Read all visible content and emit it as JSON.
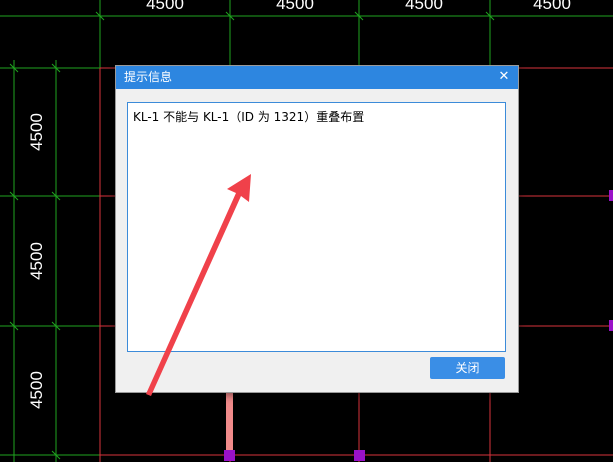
{
  "drawing": {
    "top_dimensions": [
      "4500",
      "4500",
      "4500",
      "4500"
    ],
    "left_dimensions": [
      "4500",
      "4500",
      "4500"
    ],
    "colors": {
      "background": "#000000",
      "grid_green": "#1fa51f",
      "axis_red": "#d8333c",
      "column_purple": "#9a12c8",
      "beam_fill": "#f08a8a",
      "annotation_arrow": "#f0414a"
    }
  },
  "dialog": {
    "title": "提示信息",
    "close_icon": "close-icon",
    "message": "KL-1 不能与 KL-1（ID 为 1321）重叠布置",
    "button_label": "关闭",
    "colors": {
      "titlebar": "#2d86e0",
      "button": "#3a8ee6",
      "message_border": "#3c8bd9"
    }
  }
}
